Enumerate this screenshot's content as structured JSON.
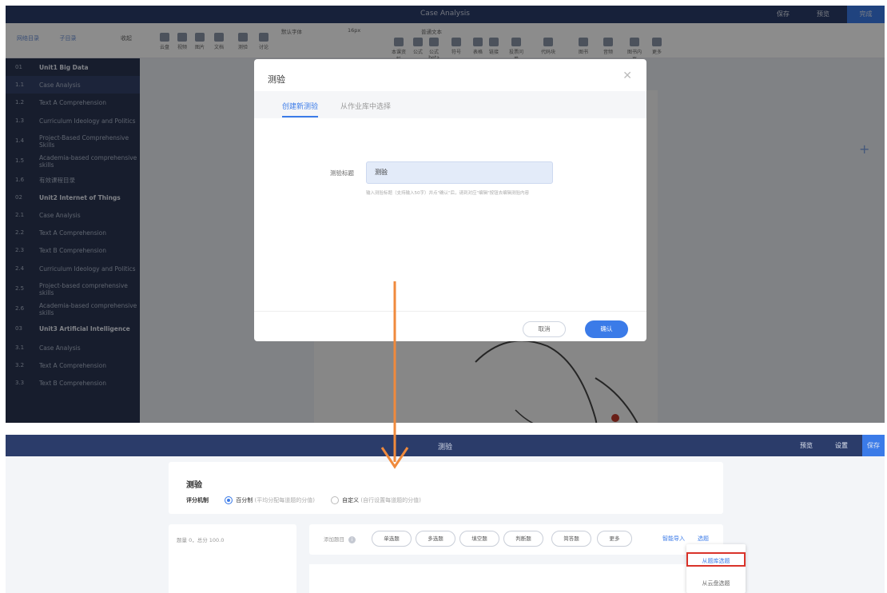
{
  "top_editor": {
    "title": "Case Analysis",
    "title_buttons": {
      "save": "保存",
      "preview": "预览",
      "publish": "完成"
    },
    "toolbar": {
      "nav_directory": "网络目录",
      "sub_directory": "子目录",
      "collapse": "收起",
      "items": [
        "云盘",
        "视频",
        "图片",
        "文档",
        "测验",
        "讨论",
        "本课资料",
        "公式",
        "公式beta",
        "符号",
        "表格",
        "链接",
        "投票问卷",
        "代码块",
        "图书",
        "音频",
        "图书内页",
        "更多"
      ],
      "font_family": "默认字体",
      "font_size": "16px",
      "text_style": "普通文本"
    },
    "sidebar": [
      {
        "num": "01",
        "label": "Unit1 Big Data",
        "unit": true
      },
      {
        "num": "1.1",
        "label": "Case Analysis",
        "active": true
      },
      {
        "num": "1.2",
        "label": "Text A Comprehension"
      },
      {
        "num": "1.3",
        "label": "Curriculum Ideology and Politics"
      },
      {
        "num": "1.4",
        "label": "Project-Based Comprehensive Skills"
      },
      {
        "num": "1.5",
        "label": "Academia-based comprehensive skills"
      },
      {
        "num": "1.6",
        "label": "有效课程目录"
      },
      {
        "num": "02",
        "label": "Unit2 Internet of Things",
        "unit": true
      },
      {
        "num": "2.1",
        "label": "Case Analysis"
      },
      {
        "num": "2.2",
        "label": "Text A Comprehension"
      },
      {
        "num": "2.3",
        "label": "Text B Comprehension"
      },
      {
        "num": "2.4",
        "label": "Curriculum Ideology and Politics"
      },
      {
        "num": "2.5",
        "label": "Project-based comprehensive skills"
      },
      {
        "num": "2.6",
        "label": "Academia-based comprehensive skills"
      },
      {
        "num": "03",
        "label": "Unit3 Artificial Intelligence",
        "unit": true
      },
      {
        "num": "3.1",
        "label": "Case Analysis"
      },
      {
        "num": "3.2",
        "label": "Text A Comprehension"
      },
      {
        "num": "3.3",
        "label": "Text B Comprehension"
      }
    ]
  },
  "modal": {
    "title": "测验",
    "tab_create": "创建新测验",
    "tab_select": "从作业库中选择",
    "field_label": "测验标题",
    "field_value": "测验",
    "field_hint": "输入测验标题（支持输入50字）并点\"确认\"后，请到对应\"编辑\"按钮去编辑测验内容",
    "cancel": "取消",
    "confirm": "确认"
  },
  "quiz_page": {
    "title": "测验",
    "buttons": {
      "preview": "预览",
      "settings": "设置",
      "save": "保存"
    },
    "card_title": "测验",
    "scoring_label": "评分机制",
    "opt_percent": "百分制",
    "opt_percent_note": "(平均分配每道题的分值)",
    "opt_custom": "自定义",
    "opt_custom_note": "(自行设置每道题的分值)",
    "summary": "题量 0，总分 100.0",
    "add_question": "添加题目",
    "types": [
      "单选题",
      "多选题",
      "填空题",
      "判断题",
      "简答题",
      "更多"
    ],
    "smart_import": "智能导入",
    "select_questions": "选题",
    "dropdown": {
      "from_bank": "从题库选题",
      "from_cloud": "从云盘选题"
    }
  },
  "colors": {
    "accent": "#3b7be8",
    "header": "#2b3c6a",
    "arrow": "#f08a3c",
    "highlight": "#d9332a"
  }
}
